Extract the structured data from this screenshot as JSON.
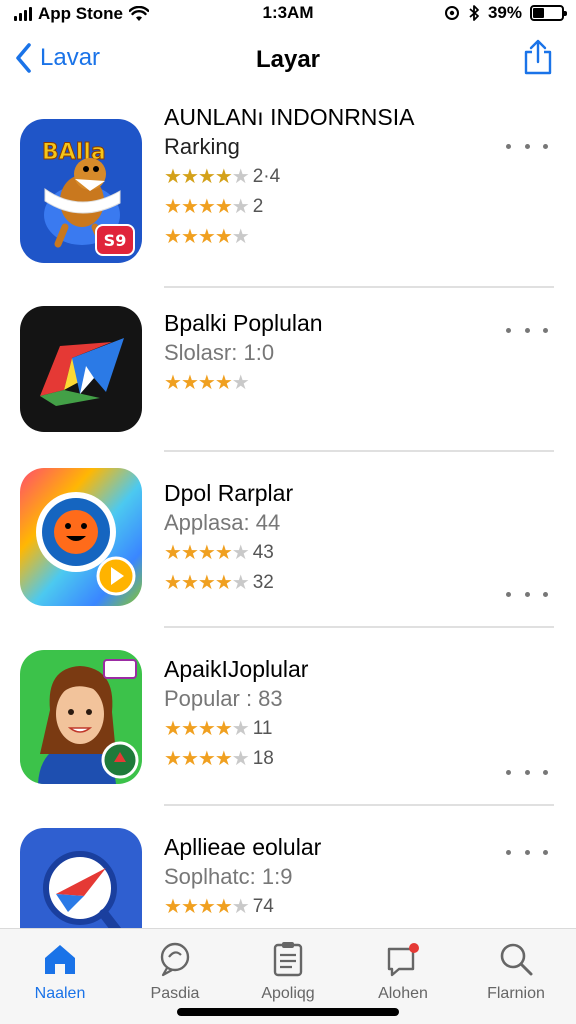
{
  "status_bar": {
    "carrier": "App Stone",
    "time": "1:3AM",
    "battery_text": "39%",
    "battery_level": 0.39
  },
  "nav": {
    "back_label": "Lavar",
    "title": "Layar"
  },
  "apps": [
    {
      "title": "AUNLANı INDONRNSIA",
      "subtitle": "Rarking",
      "ratings": [
        {
          "stars": 4,
          "value": "2·4"
        },
        {
          "stars": 4,
          "value": "2"
        },
        {
          "stars": 3.5,
          "value": ""
        }
      ],
      "icon_badge": "S9",
      "icon_text": "BAlla"
    },
    {
      "title": "Bpalki Poplulan",
      "subtitle": "Slolasr: 1:0",
      "ratings": [
        {
          "stars": 3.5,
          "value": ""
        }
      ]
    },
    {
      "title": "Dpol Rarplar",
      "subtitle": "Applasa: 44",
      "ratings": [
        {
          "stars": 4,
          "value": "43"
        },
        {
          "stars": 3.5,
          "value": "32"
        }
      ]
    },
    {
      "title": "ApaikIJoplular",
      "subtitle": "Popular : 83",
      "ratings": [
        {
          "stars": 4,
          "value": "11"
        },
        {
          "stars": 3.5,
          "value": "18"
        }
      ]
    },
    {
      "title": "Apllieаe eolular",
      "subtitle": "Soplhatc: 1:9",
      "ratings": [
        {
          "stars": 3.5,
          "value": "74"
        }
      ]
    }
  ],
  "tabs": [
    {
      "label": "Naalen",
      "icon": "home-icon",
      "active": true
    },
    {
      "label": "Pasdia",
      "icon": "search-bubble-icon",
      "active": false
    },
    {
      "label": "Apoliqg",
      "icon": "clipboard-icon",
      "active": false
    },
    {
      "label": "Alohen",
      "icon": "chat-notify-icon",
      "active": false
    },
    {
      "label": "Flarnion",
      "icon": "search-icon",
      "active": false
    }
  ],
  "colors": {
    "accent": "#1a73e8",
    "star": "#f0a020",
    "divider": "#e0e0e0"
  }
}
